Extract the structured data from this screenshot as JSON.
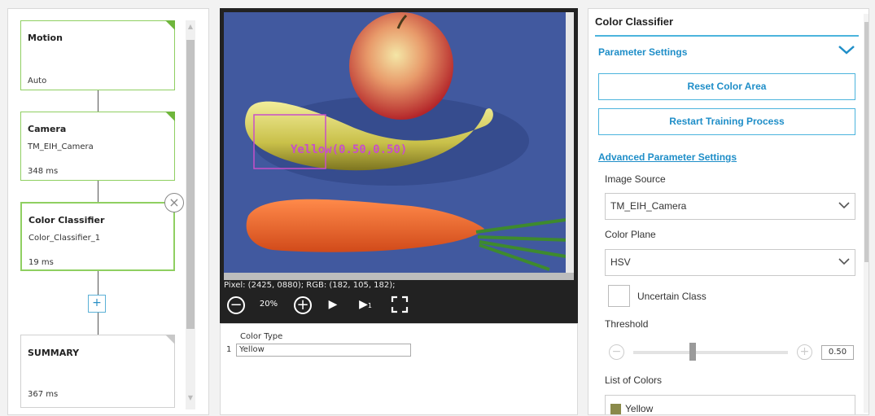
{
  "flow": {
    "nodes": [
      {
        "title": "Motion",
        "lines": [
          "Auto"
        ]
      },
      {
        "title": "Camera",
        "lines": [
          "TM_EIH_Camera",
          "348 ms"
        ]
      },
      {
        "title": "Color Classifier",
        "lines": [
          "Color_Classifier_1",
          "19 ms"
        ]
      },
      {
        "title": "SUMMARY",
        "lines": [
          "367 ms"
        ]
      }
    ]
  },
  "viewer": {
    "roi_label": "Yellow(0.50,0.50)",
    "pixel_info": "Pixel: (2425, 0880); RGB: (182, 105, 182);",
    "zoom": "20%"
  },
  "color_table": {
    "header": "Color Type",
    "rows": [
      {
        "index": "1",
        "value": "Yellow"
      }
    ]
  },
  "settings": {
    "title": "Color Classifier",
    "section": "Parameter Settings",
    "reset_button": "Reset Color Area",
    "restart_button": "Restart Training Process",
    "advanced_link": "Advanced Parameter Settings",
    "image_source_label": "Image Source",
    "image_source_value": "TM_EIH_Camera",
    "color_plane_label": "Color Plane",
    "color_plane_value": "HSV",
    "uncertain_label": "Uncertain Class",
    "threshold_label": "Threshold",
    "threshold_value": "0.50",
    "list_label": "List of Colors",
    "colors": [
      {
        "name": "Yellow",
        "swatch": "#8a8a4a"
      }
    ]
  },
  "colors": {
    "accent": "#1f8ec8",
    "node_border": "#8fcf61",
    "roi": "#c84fc8"
  }
}
